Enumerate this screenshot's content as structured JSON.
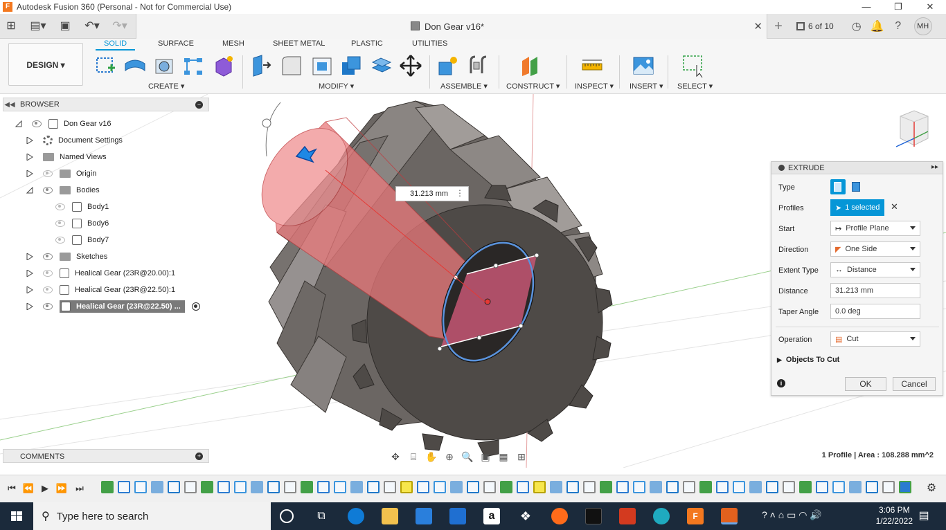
{
  "window": {
    "title": "Autodesk Fusion 360 (Personal - Not for Commercial Use)"
  },
  "tabbar": {
    "doc_title": "Don Gear v16*",
    "jobs": "6 of 10",
    "avatar": "MH"
  },
  "toolbar": {
    "design_label": "DESIGN ▾",
    "tabs": [
      "SOLID",
      "SURFACE",
      "MESH",
      "SHEET METAL",
      "PLASTIC",
      "UTILITIES"
    ],
    "groups": [
      "CREATE ▾",
      "MODIFY ▾",
      "ASSEMBLE ▾",
      "CONSTRUCT ▾",
      "INSPECT ▾",
      "INSERT ▾",
      "SELECT ▾"
    ]
  },
  "browser": {
    "title": "BROWSER",
    "items": [
      {
        "label": "Don Gear v16"
      },
      {
        "label": "Document Settings"
      },
      {
        "label": "Named Views"
      },
      {
        "label": "Origin"
      },
      {
        "label": "Bodies"
      },
      {
        "label": "Body1"
      },
      {
        "label": "Body6"
      },
      {
        "label": "Body7"
      },
      {
        "label": "Sketches"
      },
      {
        "label": "Healical Gear (23R@20.00):1"
      },
      {
        "label": "Healical Gear (23R@22.50):1"
      },
      {
        "label": "Healical Gear (23R@22.50) ..."
      }
    ]
  },
  "comments": {
    "title": "COMMENTS"
  },
  "viewport": {
    "distance_readout": "31.213 mm"
  },
  "extrude": {
    "title": "EXTRUDE",
    "type_label": "Type",
    "profiles_label": "Profiles",
    "profiles_value": "1 selected",
    "start_label": "Start",
    "start_value": "Profile Plane",
    "direction_label": "Direction",
    "direction_value": "One Side",
    "extent_label": "Extent Type",
    "extent_value": "Distance",
    "distance_label": "Distance",
    "distance_value": "31.213 mm",
    "taper_label": "Taper Angle",
    "taper_value": "0.0 deg",
    "operation_label": "Operation",
    "operation_value": "Cut",
    "objects_label": "Objects To Cut",
    "ok_label": "OK",
    "cancel_label": "Cancel"
  },
  "status": {
    "profile_info": "1 Profile | Area : 108.288 mm^2"
  },
  "taskbar": {
    "search_placeholder": "Type here to search",
    "time": "3:06 PM",
    "date": "1/22/2022"
  },
  "colors": {
    "accent": "#0696d7",
    "gear": "#5a5653",
    "cut_preview": "#e9787a"
  }
}
